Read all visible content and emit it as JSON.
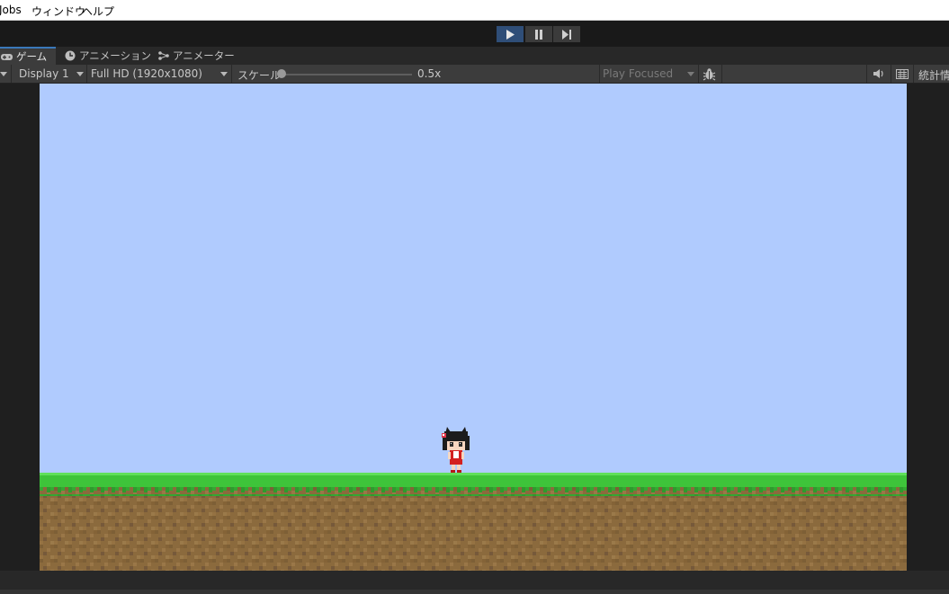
{
  "menu": {
    "items": [
      "Jobs",
      "ウィンドウ",
      "ヘルプ"
    ]
  },
  "play_toolbar": {
    "play_icon": "play-icon",
    "pause_icon": "pause-icon",
    "step_icon": "step-icon",
    "play_active": true
  },
  "tabs": [
    {
      "label": "ゲーム",
      "icon": "gamepad-icon",
      "active": true
    },
    {
      "label": "アニメーション",
      "icon": "clock-icon",
      "active": false
    },
    {
      "label": "アニメーター",
      "icon": "animator-icon",
      "active": false
    }
  ],
  "game_toolbar": {
    "display": "Display 1",
    "resolution": "Full HD (1920x1080)",
    "scale_label": "スケール",
    "scale_value": "0.5x",
    "play_mode": "Play Focused",
    "bug_icon": "bug-icon",
    "mute_icon": "speaker-icon",
    "stats_icon": "keyboard-icon",
    "stats_label": "統計情"
  },
  "game": {
    "sky_color": "#b0cbfe",
    "grass_color": "#3ec43a",
    "dirt_color": "#8b6a3d"
  }
}
